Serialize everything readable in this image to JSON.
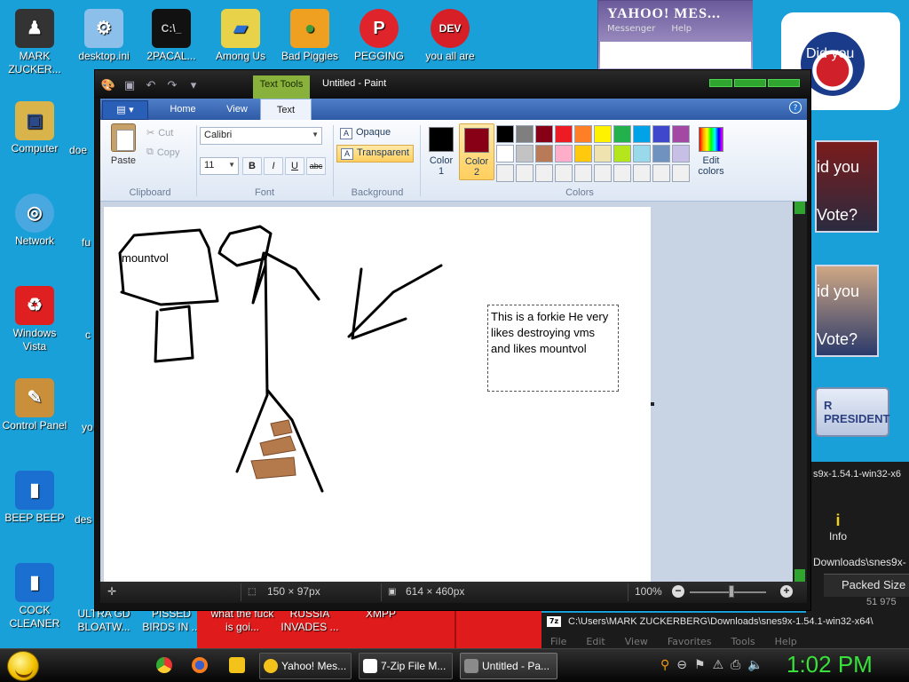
{
  "desktop": {
    "icons": [
      {
        "label": "MARK ZUCKER...",
        "icon": "user-folder-icon",
        "color": "#222222"
      },
      {
        "label": "desktop.ini",
        "icon": "settings-file-icon",
        "color": "#6fa8dc"
      },
      {
        "label": "2PACAL...",
        "icon": "console-icon",
        "color": "#111111"
      },
      {
        "label": "Among Us",
        "icon": "among-us-icon",
        "color": "#f3d21b"
      },
      {
        "label": "Bad Piggies",
        "icon": "bad-piggies-icon",
        "color": "#4caf50"
      },
      {
        "label": "PEGGING",
        "icon": "peggle-icon",
        "color": "#e0242b"
      },
      {
        "label": "you all are",
        "icon": "dev-cpp-icon",
        "color": "#d61f26"
      },
      {
        "label": "Computer",
        "icon": "computer-icon",
        "color": "#d9b44a"
      },
      {
        "label": "Network",
        "icon": "network-icon",
        "color": "#4aa8e0"
      },
      {
        "label": "Windows Vista",
        "icon": "recycle-bin-icon",
        "color": "#e02020"
      },
      {
        "label": "Control Panel",
        "icon": "control-panel-icon",
        "color": "#c98f3a"
      },
      {
        "label": "BEEP BEEP",
        "icon": "blue-app-icon",
        "color": "#1a6fd1"
      },
      {
        "label": "COCK CLEANER",
        "icon": "blue-app-icon",
        "color": "#1a6fd1"
      }
    ],
    "partial_labels": [
      "doe",
      "fu",
      "c",
      "yo",
      "des",
      "ULTRA GD BLOATW...",
      "PISSED BIRDS IN ...",
      "what the fuck is goi...",
      "RUSSIA INVADES ...",
      "XMPP"
    ]
  },
  "yahoo": {
    "title": "YAHOO! MES...",
    "menu": [
      "Messenger",
      "Help"
    ]
  },
  "web": {
    "card1": "Did you",
    "card2_l1": "id you",
    "card2_l2": "Vote?",
    "card3_l1": "id you",
    "card3_l2": "Vote?",
    "president_btn": "R PRESIDENT"
  },
  "zip": {
    "path_top": "s9x-1.54.1-win32-x6",
    "info_label": "Info",
    "path_mid": "Downloads\\snes9x-",
    "packed_size_header": "Packed Size",
    "packed_size_value": "51 975",
    "logo": "7z",
    "path_bottom": "C:\\Users\\MARK ZUCKERBERG\\Downloads\\snes9x-1.54.1-win32-x64\\",
    "menu": [
      "File",
      "Edit",
      "View",
      "Favorites",
      "Tools",
      "Help"
    ]
  },
  "paint": {
    "title": "Untitled - Paint",
    "contextual_tab": "Text Tools",
    "tabs": [
      {
        "label": "Home",
        "active": false
      },
      {
        "label": "View",
        "active": false
      },
      {
        "label": "Text",
        "active": true
      }
    ],
    "clipboard": {
      "paste": "Paste",
      "cut": "Cut",
      "copy": "Copy",
      "group": "Clipboard"
    },
    "font": {
      "family": "Calibri",
      "size": "11",
      "bold": "B",
      "italic": "I",
      "underline": "U",
      "strike": "abc",
      "group": "Font"
    },
    "background": {
      "opaque": "Opaque",
      "transparent": "Transparent",
      "selected": "transparent",
      "group": "Background"
    },
    "colors": {
      "color1_label": "Color",
      "color1_num": "1",
      "color1": "#000000",
      "color2_label": "Color",
      "color2_num": "2",
      "color2": "#880015",
      "edit": "Edit colors",
      "group": "Colors",
      "palette": [
        "#000000",
        "#7f7f7f",
        "#880015",
        "#ed1c24",
        "#ff7f27",
        "#fff200",
        "#22b14c",
        "#00a2e8",
        "#3f48cc",
        "#a349a4",
        "#ffffff",
        "#c3c3c3",
        "#b97a57",
        "#ffaec9",
        "#ffc90e",
        "#efe4b0",
        "#b5e61d",
        "#99d9ea",
        "#7092be",
        "#c8bfe7",
        "#f0f0f0",
        "#f0f0f0",
        "#f0f0f0",
        "#f0f0f0",
        "#f0f0f0",
        "#f0f0f0",
        "#f0f0f0",
        "#f0f0f0",
        "#f0f0f0",
        "#f0f0f0"
      ]
    },
    "canvas": {
      "label_text": "mountvol",
      "textbox_text": "This is a forkie He very likes destroying vms and likes mountvol"
    },
    "status": {
      "selection": "150 × 97px",
      "image_size": "614 × 460px",
      "zoom": "100%"
    }
  },
  "taskbar": {
    "buttons": [
      {
        "label": "Yahoo! Mes...",
        "icon": "yahoo-icon",
        "color": "#f3c21b"
      },
      {
        "label": "7-Zip File M...",
        "icon": "7zip-icon",
        "color": "#ffffff"
      },
      {
        "label": "Untitled - Pa...",
        "icon": "paint-icon",
        "color": "#8a8a8a",
        "active": true
      }
    ],
    "clock": "1:02 PM"
  }
}
